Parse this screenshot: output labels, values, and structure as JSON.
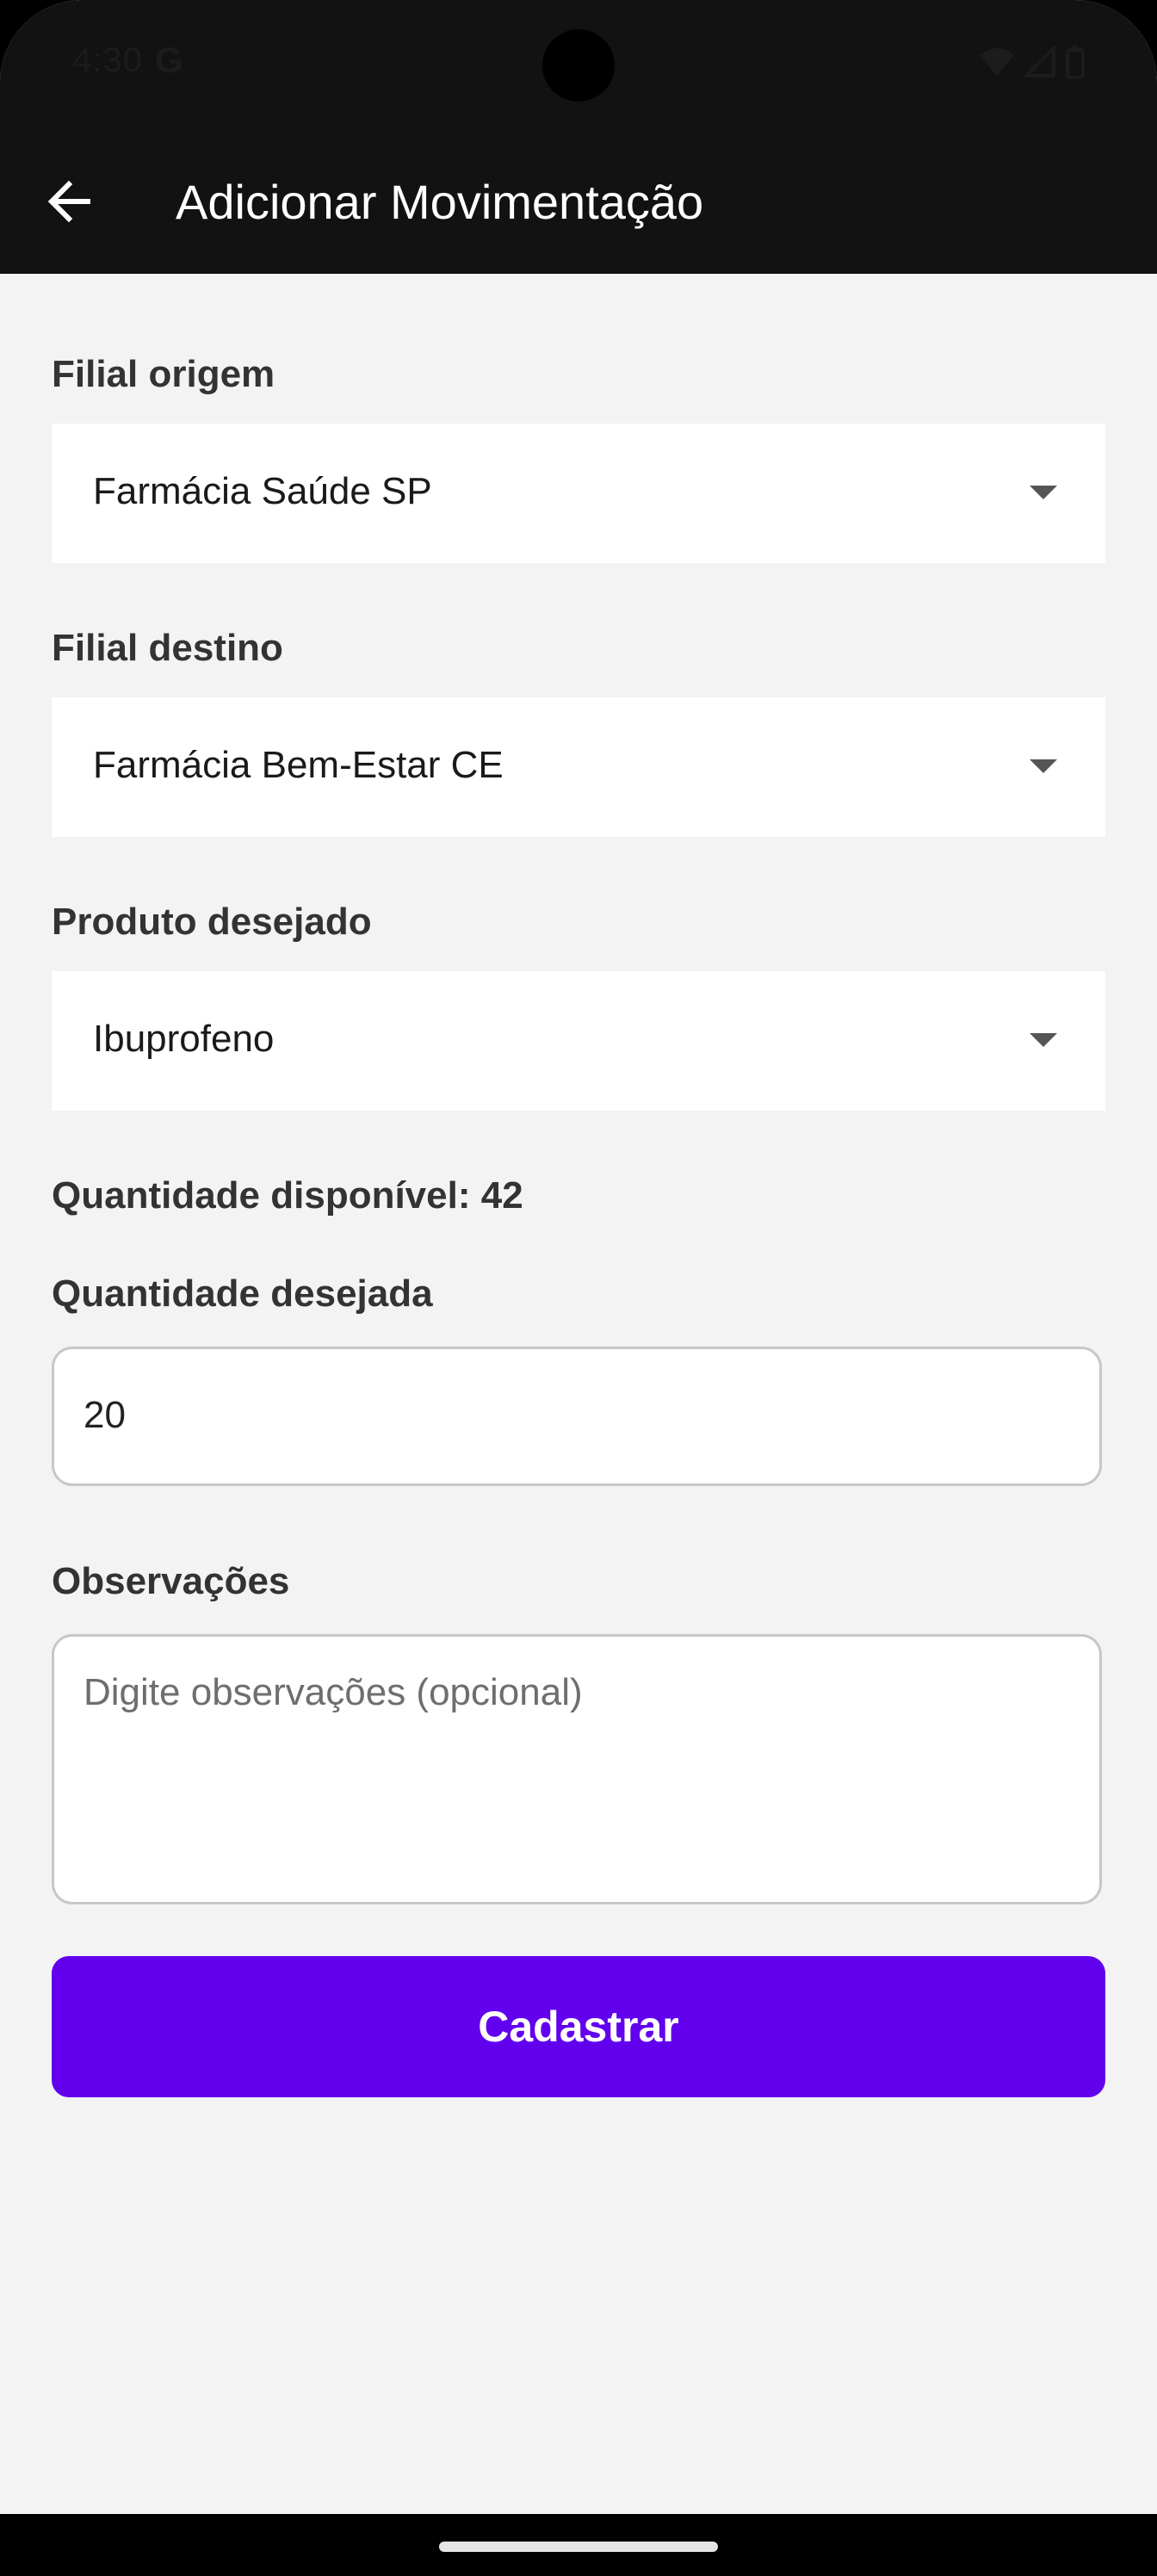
{
  "status_bar": {
    "time": "4:30",
    "google_badge": "G",
    "icons": [
      "wifi-icon",
      "cell-signal-icon",
      "battery-icon"
    ]
  },
  "app_bar": {
    "back_icon": "arrow-left-icon",
    "title": "Adicionar Movimentação"
  },
  "form": {
    "origin": {
      "label": "Filial origem",
      "value": "Farmácia Saúde SP"
    },
    "destination": {
      "label": "Filial destino",
      "value": "Farmácia Bem-Estar CE"
    },
    "product": {
      "label": "Produto desejado",
      "value": "Ibuprofeno"
    },
    "available_quantity": "Quantidade disponível: 42",
    "desired_quantity": {
      "label": "Quantidade desejada",
      "value": "20"
    },
    "notes": {
      "label": "Observações",
      "placeholder": "Digite observações (opcional)",
      "value": ""
    },
    "submit_label": "Cadastrar"
  },
  "colors": {
    "app_bar": "#121212",
    "background": "#f3f3f3",
    "primary_button": "#6200ee",
    "label_text": "#333333"
  }
}
